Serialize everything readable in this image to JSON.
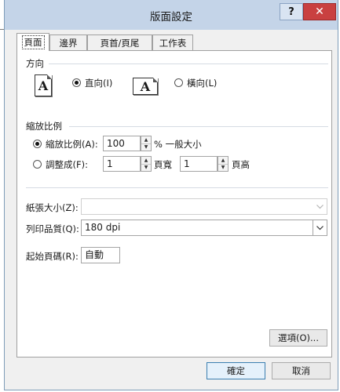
{
  "window": {
    "title": "版面設定"
  },
  "titlebar": {
    "help_label": "?",
    "close_label": "✕"
  },
  "tabs": [
    {
      "label": "頁面",
      "active": true
    },
    {
      "label": "邊界"
    },
    {
      "label": "頁首/頁尾"
    },
    {
      "label": "工作表"
    }
  ],
  "orientation": {
    "group_label": "方向",
    "portrait_label": "直向(I)",
    "portrait_checked": true,
    "landscape_label": "橫向(L)",
    "icon_letter": "A"
  },
  "scaling": {
    "group_label": "縮放比例",
    "adjust_label": "縮放比例(A):",
    "adjust_value": "100",
    "adjust_suffix": "% 一般大小",
    "fit_label": "調整成(F):",
    "fit_wide_value": "1",
    "fit_wide_suffix": "頁寬",
    "fit_tall_value": "1",
    "fit_tall_suffix": "頁高"
  },
  "paper": {
    "paper_size_label": "紙張大小(Z):",
    "paper_size_value": "",
    "print_quality_label": "列印品質(Q):",
    "print_quality_value": "180 dpi",
    "first_page_label": "起始頁碼(R):",
    "first_page_value": "自動"
  },
  "buttons": {
    "options_label": "選項(O)...",
    "ok_label": "確定",
    "cancel_label": "取消"
  },
  "colors": {
    "titlebar": "#c4d4e8",
    "close_button": "#c94040",
    "dialog_bg": "#f0f0f0",
    "default_button_border": "#3c7fb1"
  }
}
